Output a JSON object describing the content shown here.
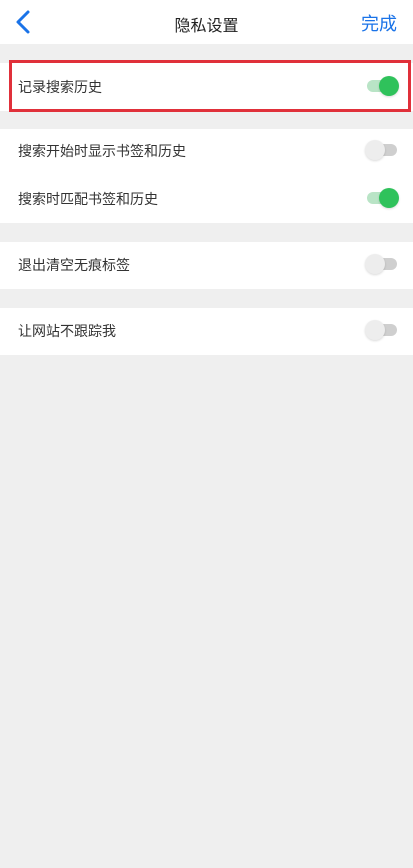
{
  "nav": {
    "title": "隐私设置",
    "done_label": "完成"
  },
  "settings": [
    {
      "label": "记录搜索历史",
      "enabled": true
    },
    {
      "label": "搜索开始时显示书签和历史",
      "enabled": false
    },
    {
      "label": "搜索时匹配书签和历史",
      "enabled": true
    },
    {
      "label": "退出清空无痕标签",
      "enabled": false
    },
    {
      "label": "让网站不跟踪我",
      "enabled": false
    }
  ],
  "colors": {
    "accent": "#1a73e8",
    "toggle_on": "#2fc25b",
    "highlight": "#e0303a"
  }
}
